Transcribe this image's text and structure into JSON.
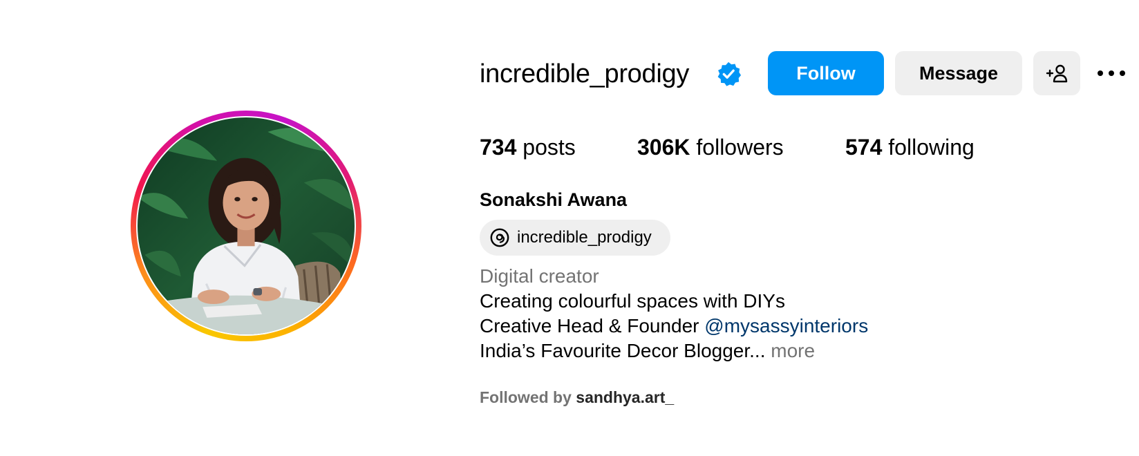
{
  "profile": {
    "username": "incredible_prodigy",
    "verified": true,
    "full_name": "Sonakshi Awana",
    "threads_handle": "incredible_prodigy",
    "category": "Digital creator",
    "bio_lines": [
      "Creating colourful spaces with DIYs",
      "Creative Head & Founder ",
      "India’s Favourite Decor Blogger... "
    ],
    "mention": "@mysassyinteriors",
    "more_label": "more",
    "followed_by_label": "Followed by ",
    "followed_by_name": "sandhya.art_"
  },
  "actions": {
    "follow_label": "Follow",
    "message_label": "Message",
    "add_user_icon": "add-person-icon",
    "more_icon": "more-options-icon"
  },
  "stats": {
    "posts_count": "734",
    "posts_label": " posts",
    "followers_count": "306K",
    "followers_label": " followers",
    "following_count": "574",
    "following_label": " following"
  },
  "colors": {
    "primary_button": "#0095f6",
    "secondary_button": "#efefef",
    "verified_badge": "#0095f6",
    "mention_link": "#00376b",
    "muted_text": "#737373"
  }
}
